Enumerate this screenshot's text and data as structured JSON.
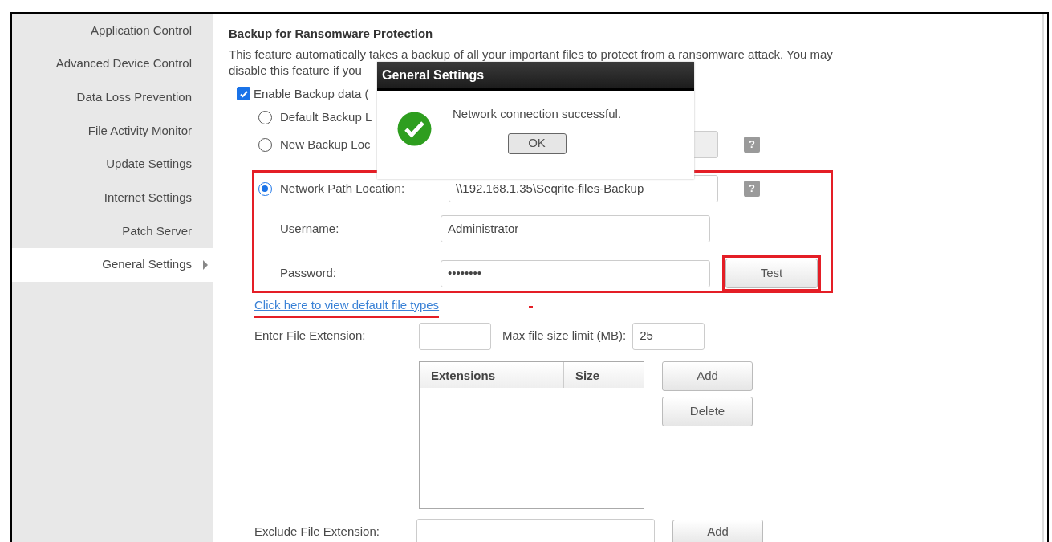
{
  "sidebar": {
    "items": [
      {
        "label": "Application Control",
        "selected": false
      },
      {
        "label": "Advanced Device Control",
        "selected": false
      },
      {
        "label": "Data Loss Prevention",
        "selected": false
      },
      {
        "label": "File Activity Monitor",
        "selected": false
      },
      {
        "label": "Update Settings",
        "selected": false
      },
      {
        "label": "Internet Settings",
        "selected": false
      },
      {
        "label": "Patch Server",
        "selected": false
      },
      {
        "label": "General Settings",
        "selected": true
      }
    ]
  },
  "section": {
    "title": "Backup for Ransomware Protection",
    "description": [
      "This feature automatically takes a backup of all your important files to protect from a ransomware attack. You may",
      "disable this feature if you"
    ],
    "enable_backup": {
      "label": "Enable Backup data (",
      "checked": true
    },
    "locations": [
      {
        "label": "Default Backup L",
        "selected": false,
        "kind": "plain"
      },
      {
        "label": "New Backup Loc",
        "selected": false,
        "kind": "field",
        "help": "?"
      },
      {
        "label": "Network Path Location:",
        "selected": true,
        "kind": "network",
        "value": "\\\\192.168.1.35\\Seqrite-files-Backup",
        "help": "?"
      }
    ],
    "username": {
      "label": "Username:",
      "value": "Administrator"
    },
    "password": {
      "label": "Password:",
      "value": "••••••••"
    },
    "test_button": "Test",
    "link": "Click here to view default file types",
    "file_extension": {
      "label": "Enter File Extension:"
    },
    "max_size": {
      "label": "Max file size limit (MB):",
      "value": "25"
    },
    "table": {
      "columns": [
        "Extensions",
        "Size"
      ]
    },
    "table_buttons": [
      "Add",
      "Delete"
    ],
    "exclude_extension": {
      "label": "Exclude File Extension:",
      "button": "Add"
    }
  },
  "dialog": {
    "title": "General Settings",
    "message": "Network connection successful.",
    "button": "OK"
  }
}
